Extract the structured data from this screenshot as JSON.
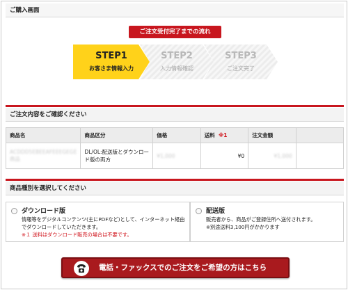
{
  "header": {
    "title": "ご購入画面"
  },
  "flow": {
    "badge": "ご注文受付完了までの流れ",
    "steps": [
      {
        "num": "STEP1",
        "label": "お客さま情報入力",
        "active": true
      },
      {
        "num": "STEP2",
        "label": "入力情報確認",
        "active": false
      },
      {
        "num": "STEP3",
        "label": "ご注文完了",
        "active": false
      }
    ]
  },
  "confirm": {
    "title": "ご注文内容をご確認ください",
    "columns": [
      "商品名",
      "商品区分",
      "価格",
      "送料",
      "注文金額"
    ],
    "shipping_note_mark": "※1",
    "row": {
      "name": "ACDDD5EBEEAFEEEGEGE商品",
      "category": "DL/OL:配送版とダウンロード版の両方",
      "price": "¥1,000",
      "shipping": "¥0",
      "total": "¥1,000"
    }
  },
  "product_type": {
    "title": "商品種別を選択してください",
    "download": {
      "title": "ダウンロード版",
      "desc1": "情報等をデジタルコンテンツ(主にPDFなど)として、インターネット経由でダウンロードしていただきます。",
      "note": "※１ 送料はダウンロード販売の場合は不要です。"
    },
    "delivery": {
      "title": "配送版",
      "desc1": "販売者から、商品がご登録住所へ送付されます。",
      "desc2": "※別途送料3,100円がかかります"
    }
  },
  "phone_button": {
    "label": "電話・ファックスでのご注文をご希望の方はこちら"
  },
  "colors": {
    "accent_red": "#c8161e",
    "step_active": "#ffd21a",
    "button_red": "#a91a1e"
  }
}
